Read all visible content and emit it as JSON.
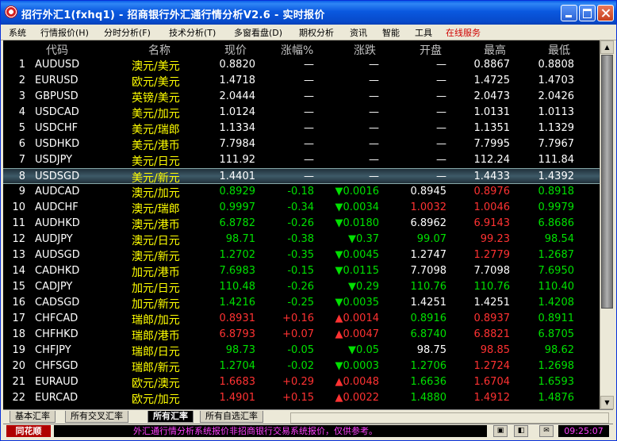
{
  "window": {
    "title": "招行外汇1(fxhq1) - 招商银行外汇通行情分析V2.6 - 实时报价"
  },
  "menu": [
    "系统",
    "行情报价(H)",
    "分时分析(F)",
    "技术分析(T)",
    "多窗看盘(D)",
    "期权分析",
    "资讯",
    "智能",
    "工具",
    "在线服务"
  ],
  "headers": [
    "代码",
    "名称",
    "现价",
    "涨幅%",
    "涨跌",
    "开盘",
    "最高",
    "最低"
  ],
  "colors": {
    "up": "#ff3232",
    "down": "#00e000",
    "name": "#ffff00"
  },
  "rows": [
    {
      "n": "1",
      "code": "AUDUSD",
      "name": "澳元/美元",
      "price": "0.8820",
      "pct": "—",
      "chg": "—",
      "open": "—",
      "high": "0.8867",
      "low": "0.8808",
      "dir": "flat",
      "hc": "flat",
      "lc": "flat",
      "oc": "flat"
    },
    {
      "n": "2",
      "code": "EURUSD",
      "name": "欧元/美元",
      "price": "1.4718",
      "pct": "—",
      "chg": "—",
      "open": "—",
      "high": "1.4725",
      "low": "1.4703",
      "dir": "flat",
      "hc": "flat",
      "lc": "flat",
      "oc": "flat"
    },
    {
      "n": "3",
      "code": "GBPUSD",
      "name": "英镑/美元",
      "price": "2.0444",
      "pct": "—",
      "chg": "—",
      "open": "—",
      "high": "2.0473",
      "low": "2.0426",
      "dir": "flat",
      "hc": "flat",
      "lc": "flat",
      "oc": "flat"
    },
    {
      "n": "4",
      "code": "USDCAD",
      "name": "美元/加元",
      "price": "1.0124",
      "pct": "—",
      "chg": "—",
      "open": "—",
      "high": "1.0131",
      "low": "1.0113",
      "dir": "flat",
      "hc": "flat",
      "lc": "flat",
      "oc": "flat"
    },
    {
      "n": "5",
      "code": "USDCHF",
      "name": "美元/瑞郎",
      "price": "1.1334",
      "pct": "—",
      "chg": "—",
      "open": "—",
      "high": "1.1351",
      "low": "1.1329",
      "dir": "flat",
      "hc": "flat",
      "lc": "flat",
      "oc": "flat"
    },
    {
      "n": "6",
      "code": "USDHKD",
      "name": "美元/港币",
      "price": "7.7984",
      "pct": "—",
      "chg": "—",
      "open": "—",
      "high": "7.7995",
      "low": "7.7967",
      "dir": "flat",
      "hc": "flat",
      "lc": "flat",
      "oc": "flat"
    },
    {
      "n": "7",
      "code": "USDJPY",
      "name": "美元/日元",
      "price": "111.92",
      "pct": "—",
      "chg": "—",
      "open": "—",
      "high": "112.24",
      "low": "111.84",
      "dir": "flat",
      "hc": "flat",
      "lc": "flat",
      "oc": "flat"
    },
    {
      "n": "8",
      "code": "USDSGD",
      "name": "美元/新元",
      "price": "1.4401",
      "pct": "—",
      "chg": "—",
      "open": "—",
      "high": "1.4433",
      "low": "1.4392",
      "dir": "flat",
      "hc": "flat",
      "lc": "flat",
      "oc": "flat",
      "selected": true
    },
    {
      "n": "9",
      "code": "AUDCAD",
      "name": "澳元/加元",
      "price": "0.8929",
      "pct": "-0.18",
      "chg": "▼0.0016",
      "open": "0.8945",
      "high": "0.8976",
      "low": "0.8918",
      "dir": "down",
      "hc": "up",
      "lc": "down",
      "oc": "flat"
    },
    {
      "n": "10",
      "code": "AUDCHF",
      "name": "澳元/瑞郎",
      "price": "0.9997",
      "pct": "-0.34",
      "chg": "▼0.0034",
      "open": "1.0032",
      "high": "1.0046",
      "low": "0.9979",
      "dir": "down",
      "hc": "up",
      "lc": "down",
      "oc": "up"
    },
    {
      "n": "11",
      "code": "AUDHKD",
      "name": "澳元/港币",
      "price": "6.8782",
      "pct": "-0.26",
      "chg": "▼0.0180",
      "open": "6.8962",
      "high": "6.9143",
      "low": "6.8686",
      "dir": "down",
      "hc": "up",
      "lc": "down",
      "oc": "flat"
    },
    {
      "n": "12",
      "code": "AUDJPY",
      "name": "澳元/日元",
      "price": "98.71",
      "pct": "-0.38",
      "chg": "▼0.37",
      "open": "99.07",
      "high": "99.23",
      "low": "98.54",
      "dir": "down",
      "hc": "up",
      "lc": "down",
      "oc": "down"
    },
    {
      "n": "13",
      "code": "AUDSGD",
      "name": "澳元/新元",
      "price": "1.2702",
      "pct": "-0.35",
      "chg": "▼0.0045",
      "open": "1.2747",
      "high": "1.2779",
      "low": "1.2687",
      "dir": "down",
      "hc": "up",
      "lc": "down",
      "oc": "flat"
    },
    {
      "n": "14",
      "code": "CADHKD",
      "name": "加元/港币",
      "price": "7.6983",
      "pct": "-0.15",
      "chg": "▼0.0115",
      "open": "7.7098",
      "high": "7.7098",
      "low": "7.6950",
      "dir": "down",
      "hc": "flat",
      "lc": "down",
      "oc": "flat"
    },
    {
      "n": "15",
      "code": "CADJPY",
      "name": "加元/日元",
      "price": "110.48",
      "pct": "-0.26",
      "chg": "▼0.29",
      "open": "110.76",
      "high": "110.76",
      "low": "110.40",
      "dir": "down",
      "hc": "down",
      "lc": "down",
      "oc": "down"
    },
    {
      "n": "16",
      "code": "CADSGD",
      "name": "加元/新元",
      "price": "1.4216",
      "pct": "-0.25",
      "chg": "▼0.0035",
      "open": "1.4251",
      "high": "1.4251",
      "low": "1.4208",
      "dir": "down",
      "hc": "flat",
      "lc": "down",
      "oc": "flat"
    },
    {
      "n": "17",
      "code": "CHFCAD",
      "name": "瑞郎/加元",
      "price": "0.8931",
      "pct": "+0.16",
      "chg": "▲0.0014",
      "open": "0.8916",
      "high": "0.8937",
      "low": "0.8911",
      "dir": "up",
      "hc": "up",
      "lc": "down",
      "oc": "down"
    },
    {
      "n": "18",
      "code": "CHFHKD",
      "name": "瑞郎/港币",
      "price": "6.8793",
      "pct": "+0.07",
      "chg": "▲0.0047",
      "open": "6.8740",
      "high": "6.8821",
      "low": "6.8705",
      "dir": "up",
      "hc": "up",
      "lc": "down",
      "oc": "down"
    },
    {
      "n": "19",
      "code": "CHFJPY",
      "name": "瑞郎/日元",
      "price": "98.73",
      "pct": "-0.05",
      "chg": "▼0.05",
      "open": "98.75",
      "high": "98.85",
      "low": "98.62",
      "dir": "down",
      "hc": "up",
      "lc": "down",
      "oc": "flat"
    },
    {
      "n": "20",
      "code": "CHFSGD",
      "name": "瑞郎/新元",
      "price": "1.2704",
      "pct": "-0.02",
      "chg": "▼0.0003",
      "open": "1.2706",
      "high": "1.2724",
      "low": "1.2698",
      "dir": "down",
      "hc": "up",
      "lc": "down",
      "oc": "down"
    },
    {
      "n": "21",
      "code": "EURAUD",
      "name": "欧元/澳元",
      "price": "1.6683",
      "pct": "+0.29",
      "chg": "▲0.0048",
      "open": "1.6636",
      "high": "1.6704",
      "low": "1.6593",
      "dir": "up",
      "hc": "up",
      "lc": "down",
      "oc": "down"
    },
    {
      "n": "22",
      "code": "EURCAD",
      "name": "欧元/加元",
      "price": "1.4901",
      "pct": "+0.15",
      "chg": "▲0.0022",
      "open": "1.4880",
      "high": "1.4912",
      "low": "1.4876",
      "dir": "up",
      "hc": "up",
      "lc": "down",
      "oc": "down"
    }
  ],
  "tabs": [
    "基本汇率",
    "所有交叉汇率",
    "所有汇率",
    "所有自选汇率"
  ],
  "active_tab": 2,
  "status": {
    "logo": "同花顺",
    "ticker": "外汇通行情分析系统报价非招商银行交易系统报价，仅供参考。",
    "time": "09:25:07"
  }
}
